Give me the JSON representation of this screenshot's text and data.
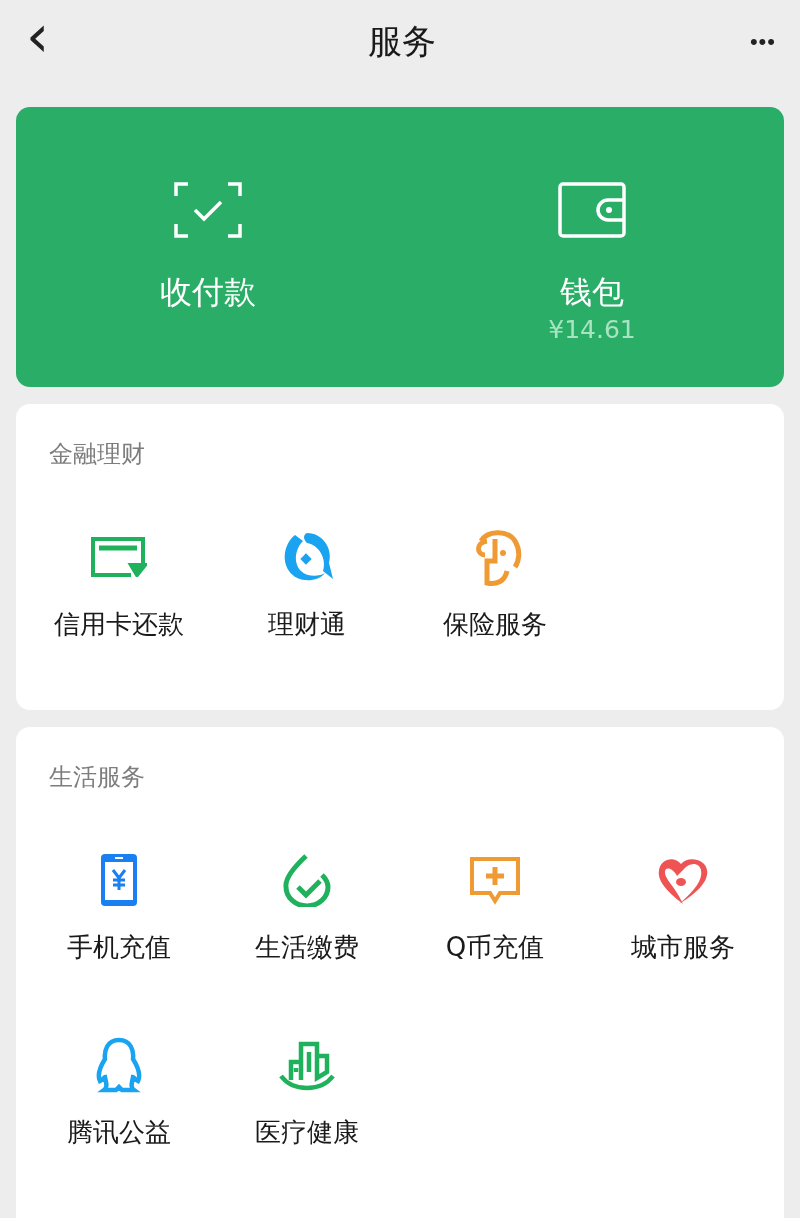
{
  "nav": {
    "back": "‹",
    "title": "服务",
    "more": "•••"
  },
  "wallet_card": {
    "items": [
      {
        "label": "收付款"
      },
      {
        "label": "钱包",
        "amount": "¥14.61"
      }
    ]
  },
  "sections": [
    {
      "title": "金融理财",
      "items": [
        {
          "label": "信用卡还款"
        },
        {
          "label": "理财通"
        },
        {
          "label": "保险服务"
        }
      ]
    },
    {
      "title": "生活服务",
      "items": [
        {
          "label": "手机充值"
        },
        {
          "label": "生活缴费"
        },
        {
          "label": "Q币充值"
        },
        {
          "label": "城市服务"
        },
        {
          "label": "腾讯公益"
        },
        {
          "label": "医疗健康"
        }
      ]
    }
  ]
}
